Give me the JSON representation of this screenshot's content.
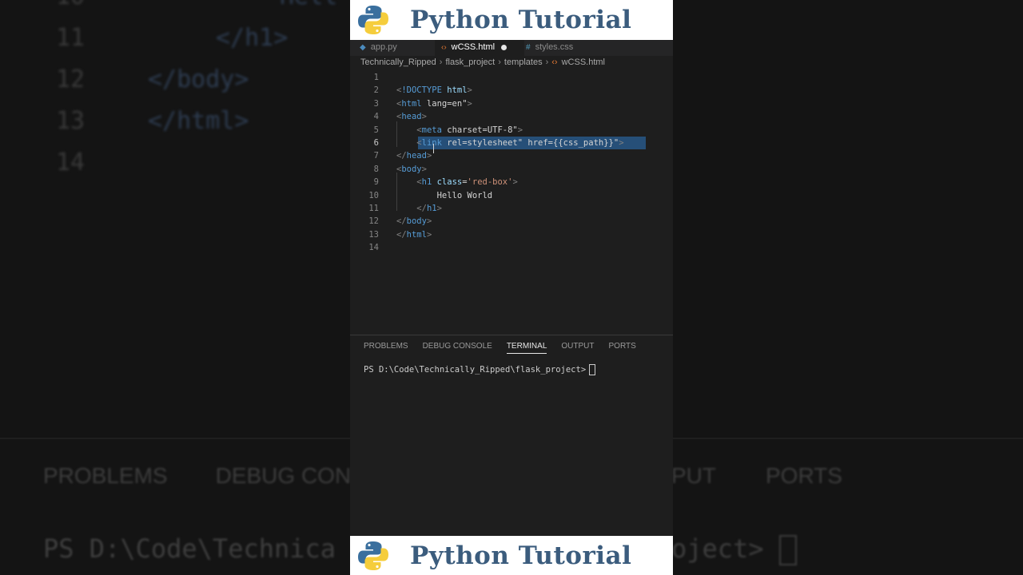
{
  "banner": {
    "title": "Python Tutorial"
  },
  "tabs": [
    {
      "label": "app.py",
      "icon": "python-file-icon",
      "active": false
    },
    {
      "label": "wCSS.html",
      "icon": "html-file-icon",
      "active": true,
      "modified": true
    },
    {
      "label": "styles.css",
      "icon": "css-file-icon",
      "active": false
    }
  ],
  "breadcrumb": [
    "Technically_Ripped",
    "flask_project",
    "templates",
    "wCSS.html"
  ],
  "editor": {
    "lines": [
      {
        "no": "1",
        "text": ""
      },
      {
        "no": "2",
        "text": "<!DOCTYPE html>"
      },
      {
        "no": "3",
        "text": "<html lang=\"en\">"
      },
      {
        "no": "4",
        "text": "<head>"
      },
      {
        "no": "5",
        "text": "    <meta charset=\"UTF-8\">"
      },
      {
        "no": "6",
        "text": "    <link rel=\"stylesheet\" href=\"{{css_path}}\">"
      },
      {
        "no": "7",
        "text": "</head>"
      },
      {
        "no": "8",
        "text": "<body>"
      },
      {
        "no": "9",
        "text": "    <h1 class='red-box'>"
      },
      {
        "no": "10",
        "text": "        Hello World"
      },
      {
        "no": "11",
        "text": "    </h1>"
      },
      {
        "no": "12",
        "text": "</body>"
      },
      {
        "no": "13",
        "text": "</html>"
      },
      {
        "no": "14",
        "text": ""
      }
    ],
    "current_line": "6"
  },
  "panel": {
    "tabs": [
      "PROBLEMS",
      "DEBUG CONSOLE",
      "TERMINAL",
      "OUTPUT",
      "PORTS"
    ],
    "active_tab": "TERMINAL",
    "prompt": "PS D:\\Code\\Technically_Ripped\\flask_project>"
  },
  "background": {
    "lines": [
      {
        "no": "10",
        "text": "Hell"
      },
      {
        "no": "11",
        "text": "</h1>"
      },
      {
        "no": "12",
        "text": "</body>"
      },
      {
        "no": "13",
        "text": "</html>"
      },
      {
        "no": "14",
        "text": ""
      }
    ],
    "tabs_left": [
      "PROBLEMS",
      "DEBUG CONS"
    ],
    "tabs_right": [
      "PUT",
      "PORTS"
    ],
    "prompt_left": "PS D:\\Code\\Technica",
    "prompt_right": "oject> "
  },
  "colors": {
    "accent": "#3b5c7d",
    "editor_bg": "#1e1e1e",
    "selection": "#264f78"
  }
}
